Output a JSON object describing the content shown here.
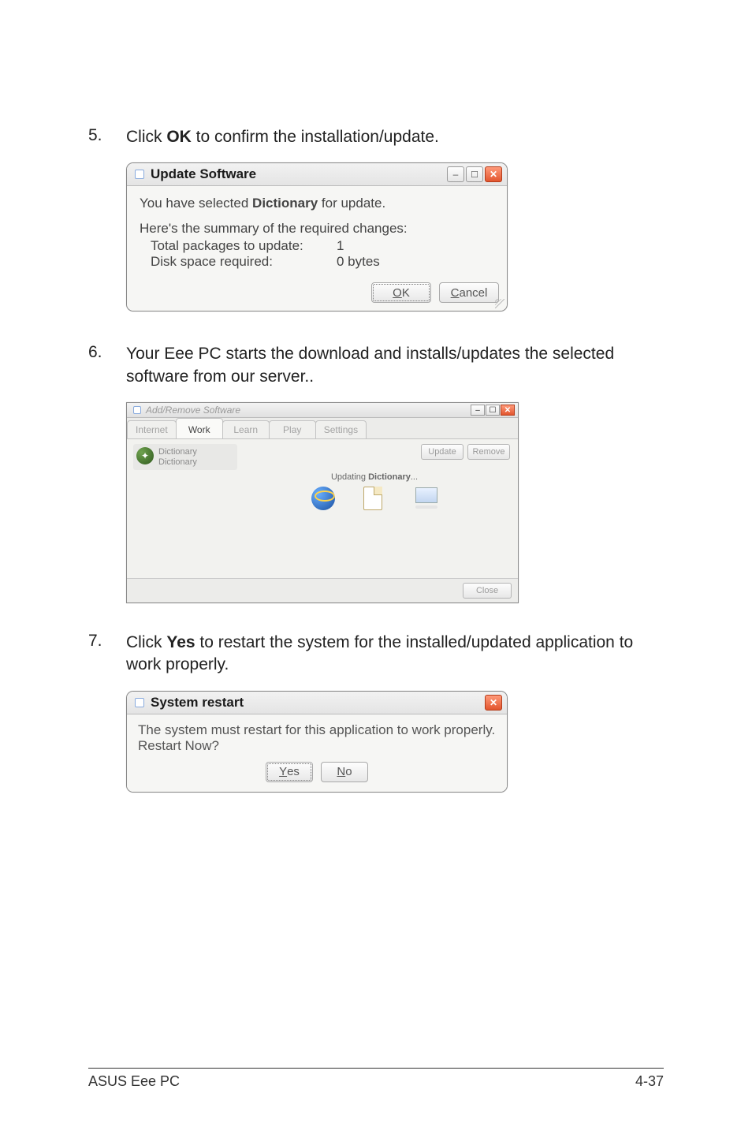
{
  "step5": {
    "num": "5.",
    "text_prefix": "Click ",
    "bold": "OK",
    "text_suffix": " to confirm the installation/update."
  },
  "dialog1": {
    "title": "Update Software",
    "line1_prefix": "You have selected ",
    "line1_bold": "Dictionary",
    "line1_suffix": " for update.",
    "line2": "Here's the summary of the required changes:",
    "row1_label": "Total packages to update:",
    "row1_value": "1",
    "row2_label": "Disk space required:",
    "row2_value": "0 bytes",
    "ok_u": "O",
    "ok_rest": "K",
    "cancel_u": "C",
    "cancel_rest": "ancel"
  },
  "step6": {
    "num": "6.",
    "text": "Your Eee PC starts the download and installs/updates the selected software from our server.."
  },
  "dialog2": {
    "title": "Add/Remove Software",
    "tabs": [
      "Internet",
      "Work",
      "Learn",
      "Play",
      "Settings"
    ],
    "active_tab_index": 1,
    "item_title": "Dictionary",
    "item_sub": "Dictionary",
    "update_btn": "Update",
    "remove_btn": "Remove",
    "status_prefix": "Updating ",
    "status_bold": "Dictionary",
    "status_suffix": "...",
    "close_btn": "Close"
  },
  "step7": {
    "num": "7.",
    "text_prefix": "Click ",
    "bold": "Yes",
    "text_suffix": " to restart the system for the installed/updated application to work properly."
  },
  "dialog3": {
    "title": "System restart",
    "body": "The system must restart for this application to work properly. Restart Now?",
    "yes_u": "Y",
    "yes_rest": "es",
    "no_u": "N",
    "no_rest": "o"
  },
  "footer": {
    "left": "ASUS Eee PC",
    "right": "4-37"
  }
}
